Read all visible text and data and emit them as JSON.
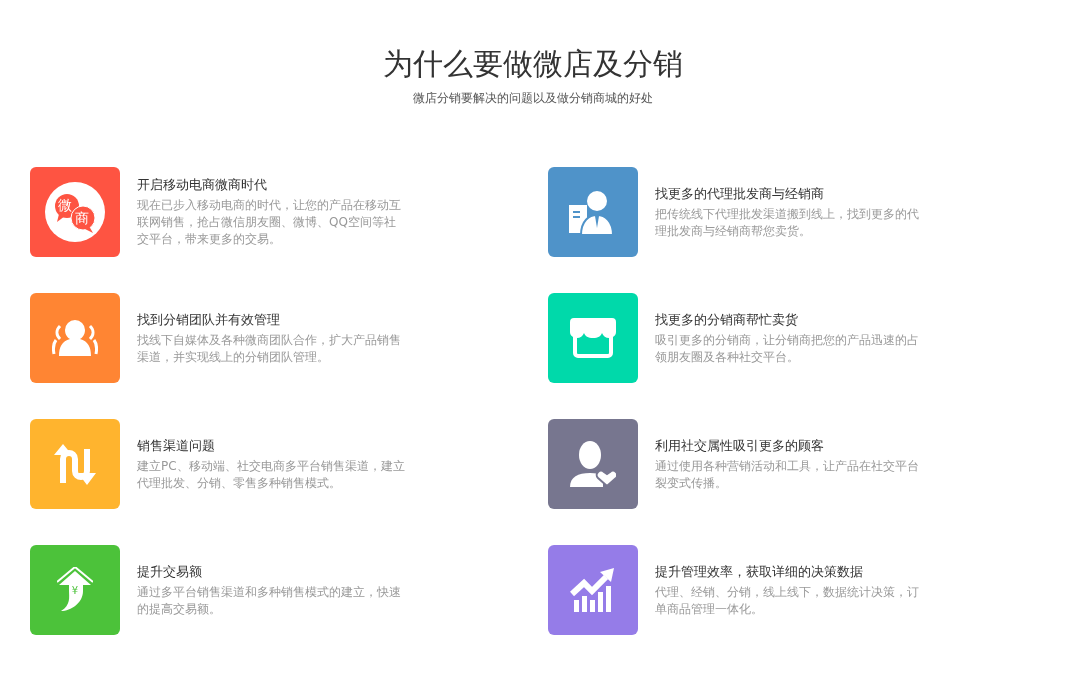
{
  "header": {
    "title": "为什么要做微店及分销",
    "subtitle": "微店分销要解决的问题以及做分销商城的好处"
  },
  "columns": [
    [
      {
        "kind": "chat",
        "color": "#fe5442",
        "icon_text": [
          "微",
          "商"
        ],
        "title": "开启移动电商微商时代",
        "description": "现在已步入移动电商的时代，让您的产品在移动互联网销售，抢占微信朋友圈、微博、QQ空间等社交平台，带来更多的交易。"
      },
      {
        "kind": "team",
        "color": "#ff8533",
        "title": "找到分销团队并有效管理",
        "description": "找线下自媒体及各种微商团队合作，扩大产品销售渠道，并实现线上的分销团队管理。"
      },
      {
        "kind": "arrows",
        "color": "#ffb42e",
        "title": "销售渠道问题",
        "description": "建立PC、移动端、社交电商多平台销售渠道，建立代理批发、分销、零售多种销售模式。"
      },
      {
        "kind": "money",
        "color": "#4cc23a",
        "icon_text": [
          "¥"
        ],
        "title": "提升交易额",
        "description": "通过多平台销售渠道和多种销售模式的建立，快速的提高交易额。"
      }
    ],
    [
      {
        "kind": "agent",
        "color": "#4f93c9",
        "title": "找更多的代理批发商与经销商",
        "description": "把传统线下代理批发渠道搬到线上，找到更多的代理批发商与经销商帮您卖货。"
      },
      {
        "kind": "shop",
        "color": "#00d9aa",
        "title": "找更多的分销商帮忙卖货",
        "description": "吸引更多的分销商，让分销商把您的产品迅速的占领朋友圈及各种社交平台。"
      },
      {
        "kind": "heart",
        "color": "#77768f",
        "title": "利用社交属性吸引更多的顾客",
        "description": "通过使用各种营销活动和工具，让产品在社交平台裂变式传播。"
      },
      {
        "kind": "chart",
        "color": "#957ce8",
        "title": "提升管理效率，获取详细的决策数据",
        "description": "代理、经销、分销，线上线下，数据统计决策，订单商品管理一体化。"
      }
    ]
  ]
}
